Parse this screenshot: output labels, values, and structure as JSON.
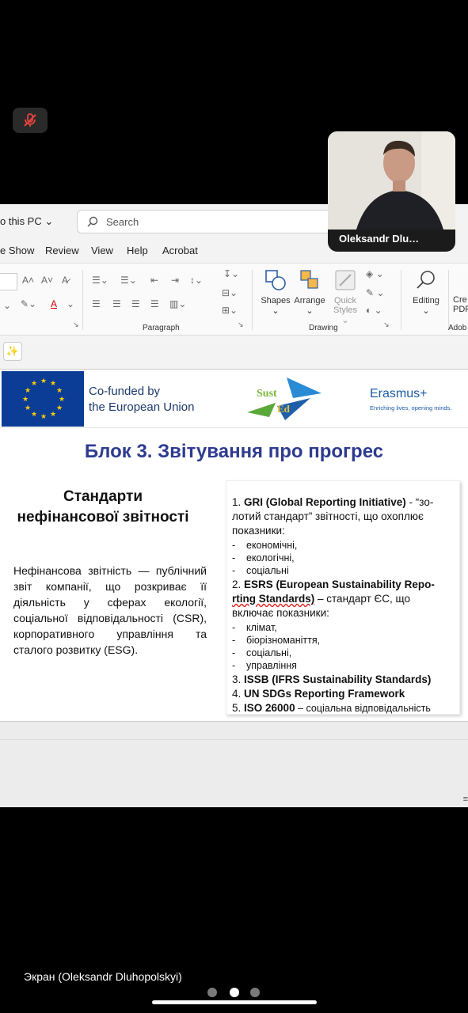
{
  "app": {
    "participant_name": "Oleksandr Dlu…",
    "screen_share_label": "Экран (Oleksandr Dluhopolskyi)",
    "pages": 3,
    "active_page": 2
  },
  "titlebar": {
    "save_location": "o this PC",
    "search_placeholder": "Search"
  },
  "menu": [
    "e Show",
    "Review",
    "View",
    "Help",
    "Acrobat"
  ],
  "ribbon": {
    "paragraph_label": "Paragraph",
    "drawing_label": "Drawing",
    "adobe_label": "Adob",
    "shapes": "Shapes",
    "arrange": "Arrange",
    "quick_styles_1": "Quick",
    "quick_styles_2": "Styles",
    "editing": "Editing",
    "create_pdf_1": "Cre",
    "create_pdf_2": "PDF"
  },
  "slide": {
    "eu_line1": "Co-funded by",
    "eu_line2": "the European Union",
    "sust_1": "Sust",
    "sust_2": "Ed",
    "erasmus": "Erasmus+",
    "erasmus_tagline": "Enriching lives, opening minds.",
    "title": "Блок 3. Звітування про прогрес",
    "left_heading_1": "Стандарти",
    "left_heading_2": "нефінансової звітності",
    "left_body": "Нефінансова звітність — публічний звіт компанії, що розкриває її діяльність у сферах екології, соціальної відповідальності (CSR), корпоративного управління та сталого розвитку (ESG).",
    "item1_num": "1.",
    "item1_bold": "GRI (Global Reporting Initiative)",
    "item1_rest_a": " - “зо-",
    "item1_rest_b": "лотий стандарт” звітності, що охоплює",
    "item1_rest_c": "показники:",
    "item1_sub": [
      "економічні,",
      "екологічні,",
      "соціальні"
    ],
    "item2_num": "2.",
    "item2_bold_a": "ESRS (European Sustainability Repo-",
    "item2_bold_b": "rting Standards)",
    "item2_rest_b": " – стандарт ЄС, що",
    "item2_rest_c": "включає показники:",
    "item2_sub": [
      "клімат,",
      "біорізноманіття,",
      "соціальні,",
      "управління"
    ],
    "item3_num": "3.",
    "item3_bold": "ISSB (IFRS Sustainability Standards)",
    "item4_num": "4.",
    "item4_bold": "UN SDGs Reporting Framework",
    "item5_num": "5.",
    "item5_bold": "ISO 26000",
    "item5_rest": " – соціальна відповідальність"
  },
  "colors": {
    "title_blue": "#2e3b8f",
    "eu_blue": "#0c3d96",
    "eu_star": "#ffcc00",
    "erasmus_blue": "#1a5aa6"
  }
}
